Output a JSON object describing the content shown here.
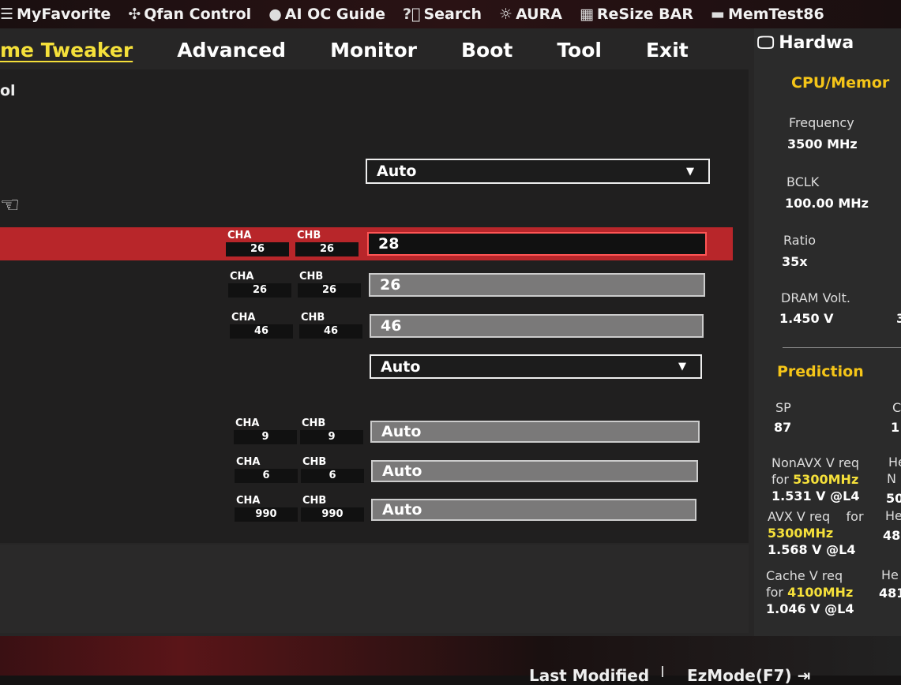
{
  "topbar": {
    "items": [
      {
        "icon": "list-icon",
        "label": "MyFavorite"
      },
      {
        "icon": "fan-icon",
        "label": "Qfan Control"
      },
      {
        "icon": "bulb-icon",
        "label": "AI OC Guide"
      },
      {
        "icon": "question-icon",
        "label": "Search"
      },
      {
        "icon": "aura-icon",
        "label": "AURA"
      },
      {
        "icon": "resize-bar-icon",
        "label": "ReSize BAR"
      },
      {
        "icon": "memtest-icon",
        "label": "MemTest86"
      }
    ]
  },
  "menu": {
    "tabs": [
      "me Tweaker",
      "Advanced",
      "Monitor",
      "Boot",
      "Tool",
      "Exit"
    ],
    "active": 0
  },
  "content": {
    "partial_label": "ol",
    "dropdown1": "Auto",
    "rows": [
      {
        "cha": "26",
        "chb": "26",
        "value": "28",
        "selected": true
      },
      {
        "cha": "26",
        "chb": "26",
        "value": "26"
      },
      {
        "cha": "46",
        "chb": "46",
        "value": "46"
      }
    ],
    "dropdown2": "Auto",
    "rows2": [
      {
        "cha": "9",
        "chb": "9",
        "value": "Auto"
      },
      {
        "cha": "6",
        "chb": "6",
        "value": "Auto"
      },
      {
        "cha": "990",
        "chb": "990",
        "value": "Auto"
      }
    ],
    "cha_label": "CHA",
    "chb_label": "CHB"
  },
  "side": {
    "title": "Hardwa",
    "section1": "CPU/Memor",
    "frequency_label": "Frequency",
    "frequency": "3500 MHz",
    "bclk_label": "BCLK",
    "bclk": "100.00 MHz",
    "ratio_label": "Ratio",
    "ratio": "35x",
    "dram_label": "DRAM Volt.",
    "dram": "1.450 V",
    "dram_right": "3",
    "section2": "Prediction",
    "sp_label": "SP",
    "sp": "87",
    "c_label": "C",
    "c_val": "1",
    "nonavx_label": "NonAVX V req",
    "nonavx_for": "for",
    "nonavx_freq": "5300MHz",
    "nonavx_v": "1.531 V @L4",
    "avx_label": "AVX V req",
    "avx_for": "for",
    "avx_freq": "5300MHz",
    "avx_v": "1.568 V @L4",
    "cache_label": "Cache V req",
    "cache_for": "for",
    "cache_freq": "4100MHz",
    "cache_v": "1.046 V @L4",
    "r1": "He",
    "r2": "N",
    "r3": "50",
    "r4": "He",
    "r5": "48",
    "r6": "He",
    "r7": "481"
  },
  "bottom": {
    "last_modified": "Last Modified",
    "ezmode": "EzMode(F7)"
  }
}
